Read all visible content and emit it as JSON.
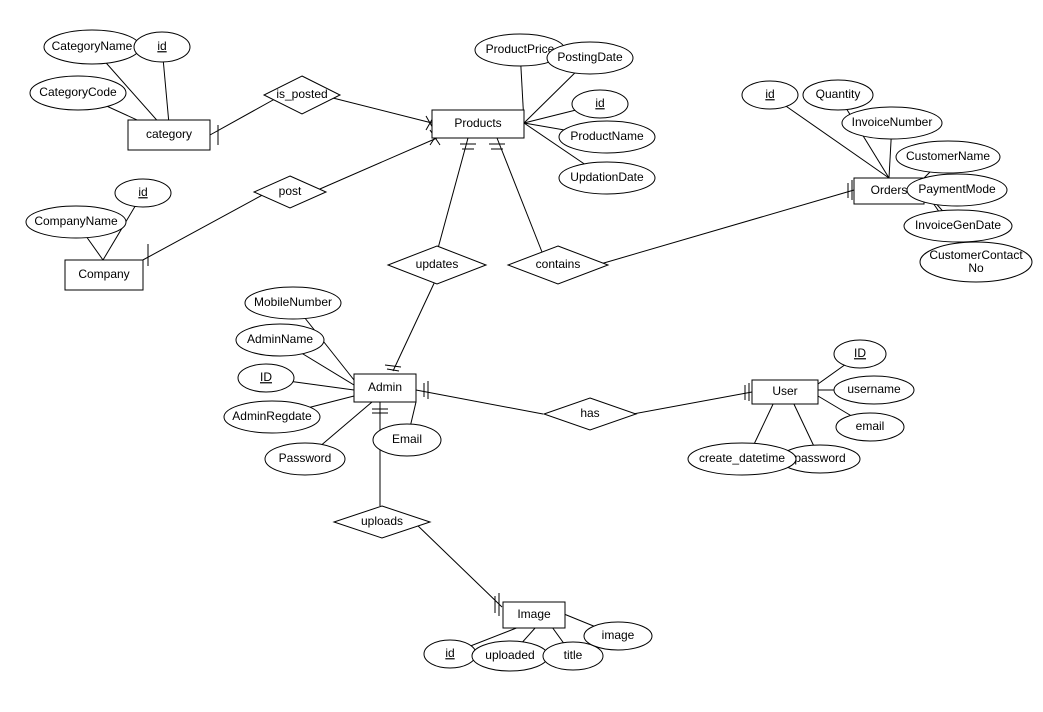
{
  "entities": {
    "category": {
      "label": "category",
      "attrs": {
        "CategoryName": "CategoryName",
        "CategoryCode": "CategoryCode",
        "id": "id"
      }
    },
    "Company": {
      "label": "Company",
      "attrs": {
        "CompanyName": "CompanyName",
        "id": "id"
      }
    },
    "Products": {
      "label": "Products",
      "attrs": {
        "ProductPrice": "ProductPrice",
        "PostingDate": "PostingDate",
        "id": "id",
        "ProductName": "ProductName",
        "UpdationDate": "UpdationDate"
      }
    },
    "Orders": {
      "label": "Orders",
      "attrs": {
        "id": "id",
        "Quantity": "Quantity",
        "InvoiceNumber": "InvoiceNumber",
        "CustomerName": "CustomerName",
        "PaymentMode": "PaymentMode",
        "InvoiceGenDate": "InvoiceGenDate",
        "CustomerContactNo": "CustomerContact\nNo"
      }
    },
    "Admin": {
      "label": "Admin",
      "attrs": {
        "MobileNumber": "MobileNumber",
        "AdminName": "AdminName",
        "ID": "ID",
        "AdminRegdate": "AdminRegdate",
        "Password": "Password",
        "Email": "Email"
      }
    },
    "User": {
      "label": "User",
      "attrs": {
        "ID": "ID",
        "username": "username",
        "email": "email",
        "password": "password",
        "create_datetime": "create_datetime"
      }
    },
    "Image": {
      "label": "Image",
      "attrs": {
        "id": "id",
        "uploaded": "uploaded",
        "title": "title",
        "image": "image"
      }
    }
  },
  "relationships": {
    "is_posted": "is_posted",
    "post": "post",
    "updates": "updates",
    "contains": "contains",
    "has": "has",
    "uploads": "uploads"
  }
}
